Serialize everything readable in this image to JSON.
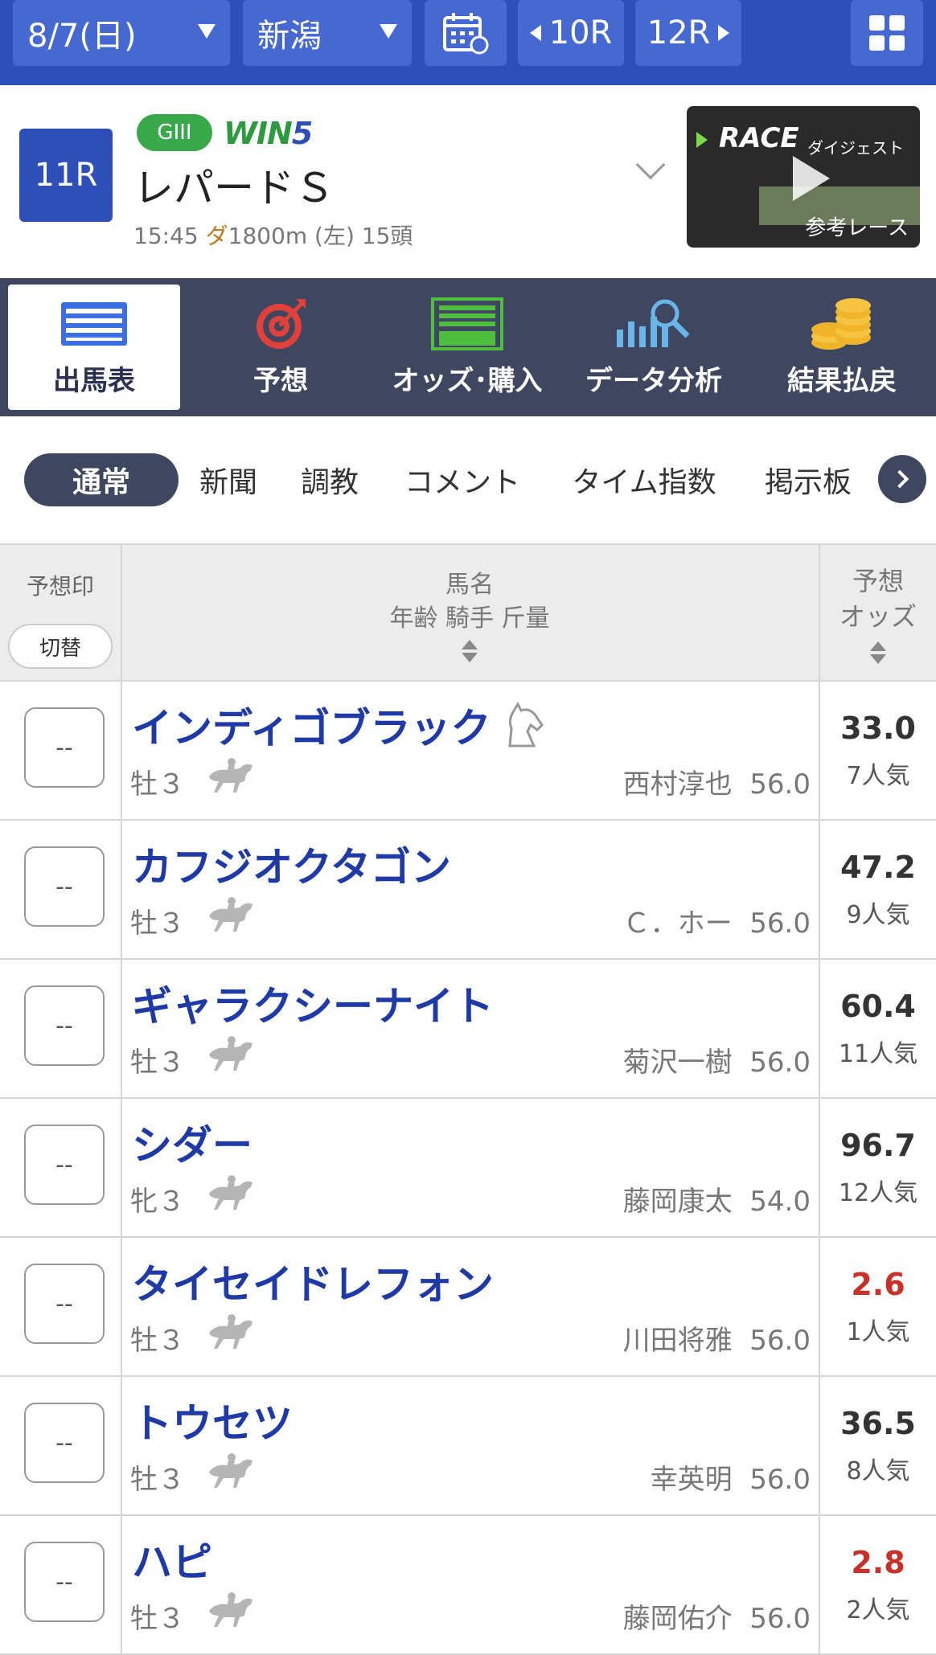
{
  "topbar": {
    "date": "8/7(日)",
    "place": "新潟",
    "prev_race": "10R",
    "next_race": "12R"
  },
  "race": {
    "number": "11R",
    "grade": "GIII",
    "win5_a": "WIN",
    "win5_b": "5",
    "name": "レパードＳ",
    "time": "15:45",
    "surface": "ダ",
    "distance": "1800m (左) 15頭",
    "digest_title": "RACE",
    "digest_sub": "ダイジェスト",
    "digest_label": "参考レース"
  },
  "main_tabs": [
    {
      "label": "出馬表",
      "icon": "race-card-icon",
      "active": true
    },
    {
      "label": "予想",
      "icon": "target-icon",
      "active": false
    },
    {
      "label": "オッズ･購入",
      "icon": "ipat-icon",
      "active": false
    },
    {
      "label": "データ分析",
      "icon": "chart-search-icon",
      "active": false
    },
    {
      "label": "結果払戻",
      "icon": "coins-icon",
      "active": false
    }
  ],
  "sub_tabs": [
    "通常",
    "新聞",
    "調教",
    "コメント",
    "タイム指数",
    "掲示板"
  ],
  "table": {
    "col_mark": "予想印",
    "toggle": "切替",
    "col_name_1": "馬名",
    "col_name_2": "年齢 騎手 斤量",
    "col_odds_1": "予想",
    "col_odds_2": "オッズ"
  },
  "rows": [
    {
      "mark": "--",
      "name": "インディゴブラック",
      "sexage": "牡３",
      "jockey": "西村淳也",
      "weight": "56.0",
      "odds": "33.0",
      "pop": "7人気",
      "fav": false
    },
    {
      "mark": "--",
      "name": "カフジオクタゴン",
      "sexage": "牡３",
      "jockey": "Ｃ．ホー",
      "weight": "56.0",
      "odds": "47.2",
      "pop": "9人気",
      "fav": false
    },
    {
      "mark": "--",
      "name": "ギャラクシーナイト",
      "sexage": "牡３",
      "jockey": "菊沢一樹",
      "weight": "56.0",
      "odds": "60.4",
      "pop": "11人気",
      "fav": false
    },
    {
      "mark": "--",
      "name": "シダー",
      "sexage": "牝３",
      "jockey": "藤岡康太",
      "weight": "54.0",
      "odds": "96.7",
      "pop": "12人気",
      "fav": false
    },
    {
      "mark": "--",
      "name": "タイセイドレフォン",
      "sexage": "牡３",
      "jockey": "川田将雅",
      "weight": "56.0",
      "odds": "2.6",
      "pop": "1人気",
      "fav": true
    },
    {
      "mark": "--",
      "name": "トウセツ",
      "sexage": "牡３",
      "jockey": "幸英明",
      "weight": "56.0",
      "odds": "36.5",
      "pop": "8人気",
      "fav": false
    },
    {
      "mark": "--",
      "name": "ハピ",
      "sexage": "牡３",
      "jockey": "藤岡佑介",
      "weight": "56.0",
      "odds": "2.8",
      "pop": "2人気",
      "fav": true
    }
  ],
  "colors": {
    "primary": "#2f4fb8",
    "nav": "#3e4660",
    "horse_name": "#1f3aa6",
    "favorite_odds": "#c8302a"
  }
}
